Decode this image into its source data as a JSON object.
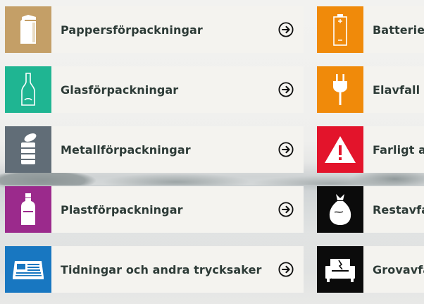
{
  "categories_left": [
    {
      "label": "Pappersförpackningar",
      "color": "#c49f67",
      "icon": "paper-carton-icon"
    },
    {
      "label": "Glasförpackningar",
      "color": "#1fb592",
      "icon": "glass-bottle-icon"
    },
    {
      "label": "Metallförpackningar",
      "color": "#616d77",
      "icon": "metal-can-icon"
    },
    {
      "label": "Plastförpackningar",
      "color": "#9b2a8c",
      "icon": "plastic-bottle-icon"
    },
    {
      "label": "Tidningar och andra trycksaker",
      "color": "#1877c1",
      "icon": "newspaper-icon"
    }
  ],
  "categories_right": [
    {
      "label": "Batterier",
      "color": "#f08a0a",
      "icon": "battery-icon"
    },
    {
      "label": "Elavfall",
      "color": "#f08a0a",
      "icon": "plug-icon"
    },
    {
      "label": "Farligt av",
      "color": "#e3142b",
      "icon": "warning-icon"
    },
    {
      "label": "Restavfal",
      "color": "#0b0b0b",
      "icon": "trash-bag-icon"
    },
    {
      "label": "Grovavfal",
      "color": "#0b0b0b",
      "icon": "armchair-icon"
    }
  ],
  "arrow_icon": "arrow-right-circle-icon"
}
